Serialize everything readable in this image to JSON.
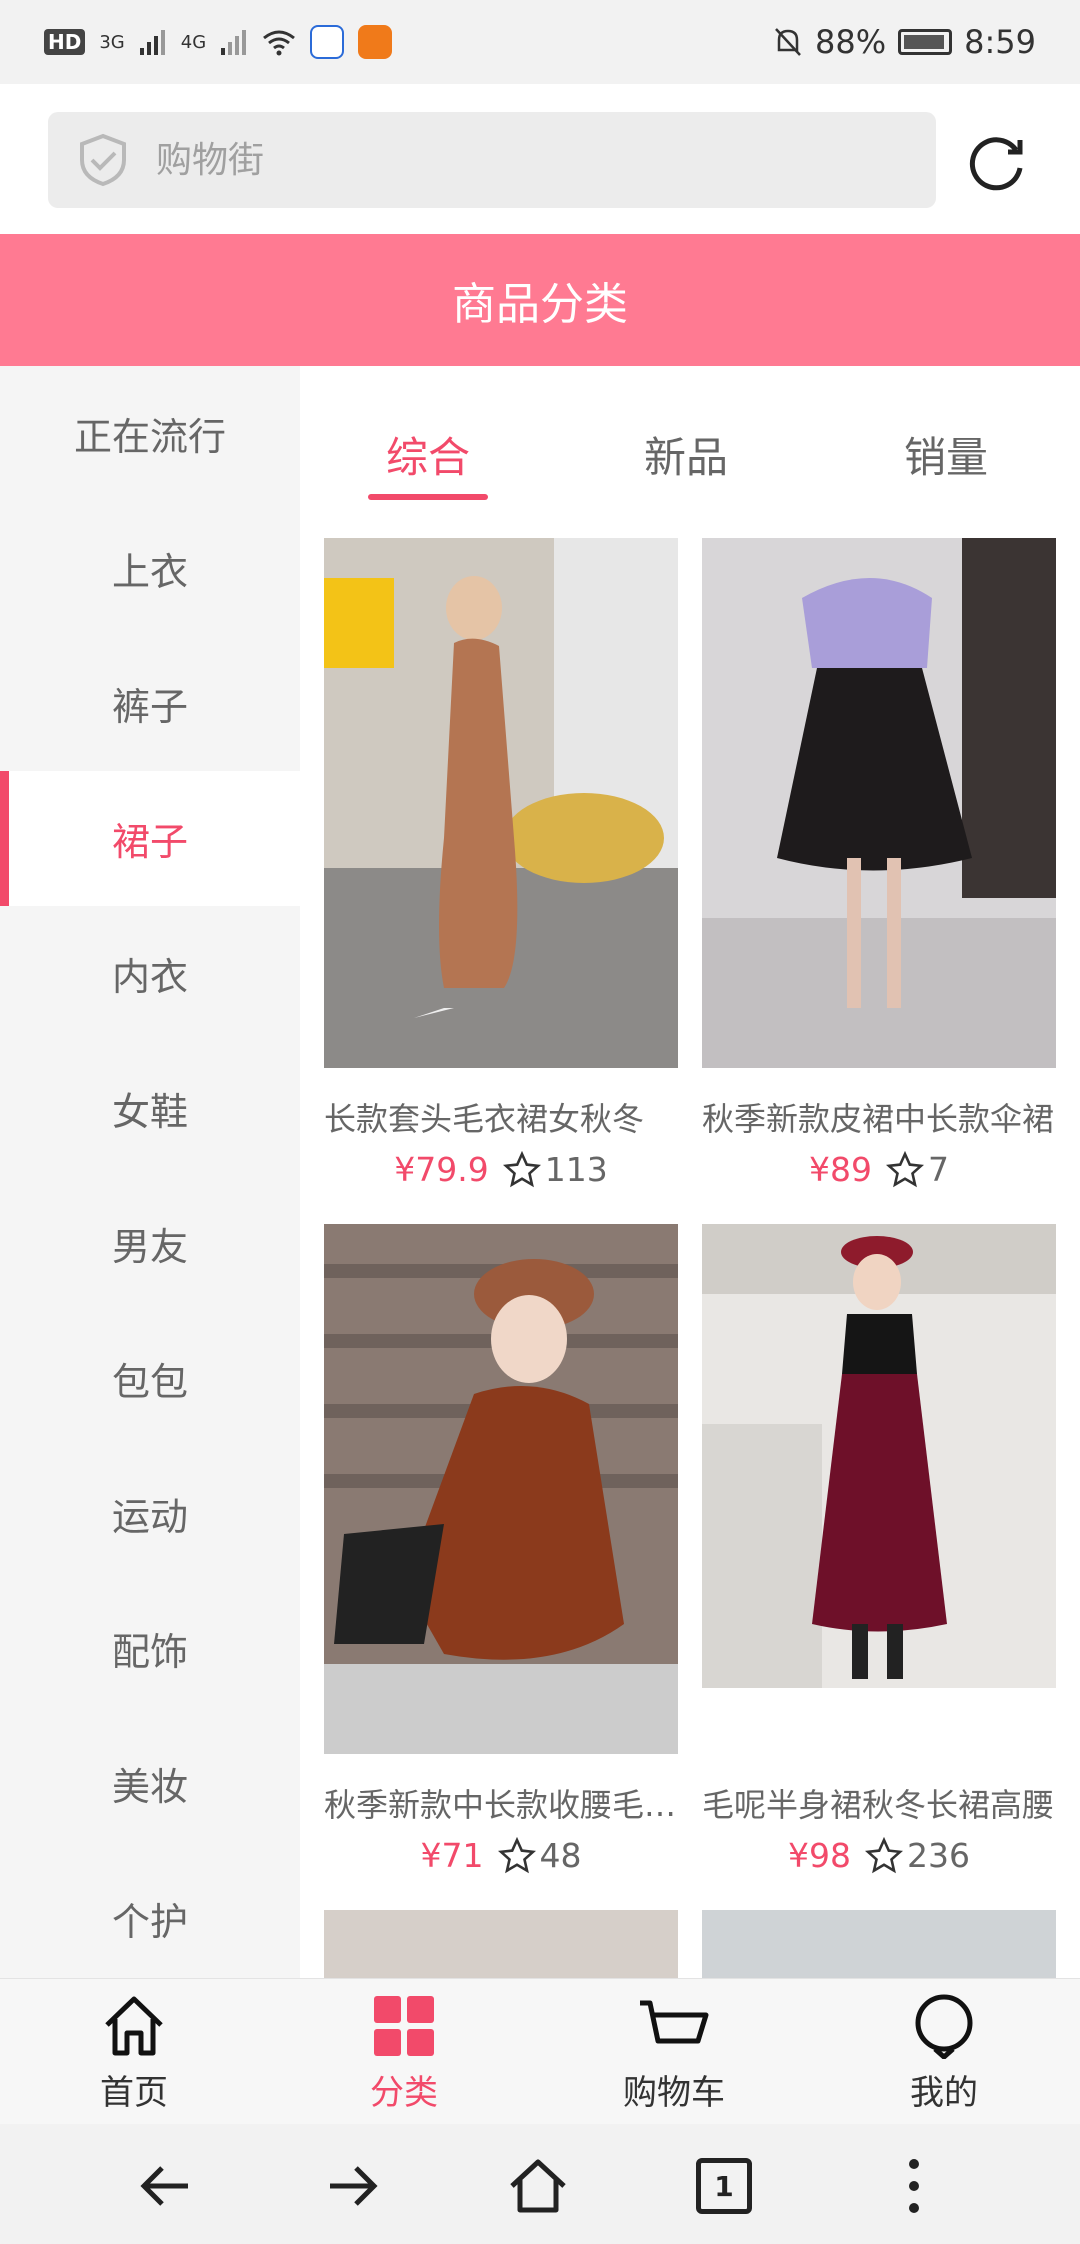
{
  "status_bar": {
    "network_label": "HD",
    "signal_3g": "3G",
    "signal_4g": "4G",
    "battery": "88%",
    "time": "8:59"
  },
  "address_bar": {
    "placeholder": "购物街"
  },
  "header": {
    "title": "商品分类"
  },
  "categories": [
    {
      "label": "正在流行"
    },
    {
      "label": "上衣"
    },
    {
      "label": "裤子"
    },
    {
      "label": "裙子",
      "active": true
    },
    {
      "label": "内衣"
    },
    {
      "label": "女鞋"
    },
    {
      "label": "男友"
    },
    {
      "label": "包包"
    },
    {
      "label": "运动"
    },
    {
      "label": "配饰"
    },
    {
      "label": "美妆"
    },
    {
      "label": "个护"
    }
  ],
  "tabs": [
    {
      "label": "综合",
      "active": true
    },
    {
      "label": "新品"
    },
    {
      "label": "销量"
    }
  ],
  "products": [
    {
      "title": "长款套头毛衣裙女秋冬",
      "price": "¥79.9",
      "favorites": "113"
    },
    {
      "title": "秋季新款皮裙中长款伞裙",
      "price": "¥89",
      "favorites": "7"
    },
    {
      "title": "秋季新款中长款收腰毛衣裙",
      "price": "¥71",
      "favorites": "48"
    },
    {
      "title": "毛呢半身裙秋冬长裙高腰",
      "price": "¥98",
      "favorites": "236"
    }
  ],
  "app_nav": [
    {
      "label": "首页",
      "icon": "home-icon"
    },
    {
      "label": "分类",
      "icon": "category-grid-icon",
      "active": true
    },
    {
      "label": "购物车",
      "icon": "cart-icon"
    },
    {
      "label": "我的",
      "icon": "profile-icon"
    }
  ],
  "browser_bar": {
    "tab_count": "1"
  },
  "colors": {
    "accent": "#f24a6a",
    "header_bg": "#ff7a92"
  }
}
